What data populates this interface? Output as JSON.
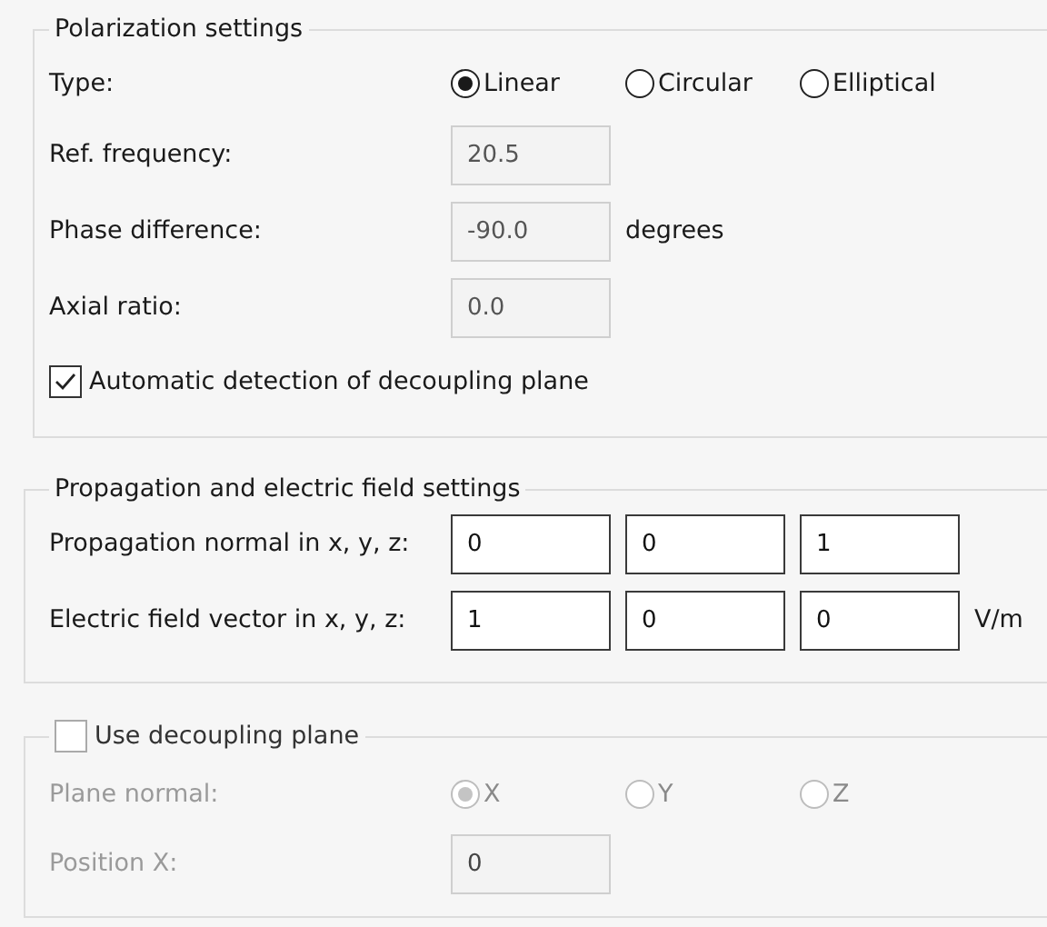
{
  "polarization_settings": {
    "title": "Polarization settings",
    "type": {
      "label": "Type:",
      "options": [
        {
          "label": "Linear",
          "selected": true
        },
        {
          "label": "Circular",
          "selected": false
        },
        {
          "label": "Elliptical",
          "selected": false
        }
      ]
    },
    "fields": [
      {
        "label": "Ref. frequency:",
        "value": "20.5",
        "read_only": true
      },
      {
        "label": "Phase difference:",
        "value": "-90.0",
        "unit": "degrees",
        "read_only": true
      },
      {
        "label": "Axial ratio:",
        "value": "0.0",
        "read_only": true
      }
    ],
    "auto_detection": {
      "label": "Automatic detection of decoupling plane",
      "checked": true
    }
  },
  "propagation_settings": {
    "title": "Propagation and electric field settings",
    "rows": [
      {
        "label": "Propagation normal in x, y, z:",
        "values": [
          "0",
          "0",
          "1"
        ]
      },
      {
        "label": "Electric field vector in x, y, z:",
        "values": [
          "1",
          "0",
          "0"
        ],
        "unit": "V/m"
      }
    ]
  },
  "decoupling_plane": {
    "label": "Use decoupling plane",
    "checked": false,
    "disabled": true,
    "plane_normal": {
      "label": "Plane normal:",
      "options": [
        {
          "label": "X",
          "selected": true
        },
        {
          "label": "Y",
          "selected": false
        },
        {
          "label": "Z",
          "selected": false
        }
      ]
    },
    "position": {
      "label": "Position X:",
      "value": "0"
    }
  }
}
